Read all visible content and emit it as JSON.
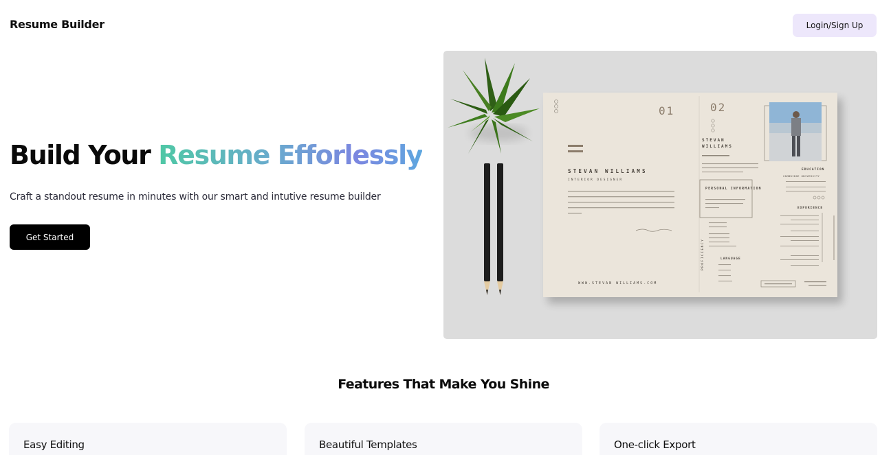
{
  "header": {
    "brand": "Resume Builder",
    "login_label": "Login/Sign Up"
  },
  "hero": {
    "title_plain": "Build Your ",
    "title_highlight": "Resume Efforlessly",
    "subtitle": "Craft a standout resume in minutes with our smart and intutive resume builder",
    "cta_label": "Get Started",
    "gradient_colors": [
      "#4fc8a5",
      "#6aa9cf",
      "#7b86e0",
      "#5ea7df"
    ]
  },
  "resume_mockup": {
    "page_one_number": "01",
    "page_two_number": "02",
    "name": "STEVAN WILLIAMS",
    "role": "INTERIOR DESIGNER",
    "name_first": "STEVAN",
    "name_last": "WILLIAMS",
    "personal_info_heading": "PERSONAL INFORMATION",
    "education_heading": "EDUCATION",
    "education_school": "CAMBRIDGE UNIVERSITY",
    "experience_heading": "EXPERIENCE",
    "language_heading": "LANGUAGE",
    "proficiency_label": "PROFICIENCY",
    "website": "WWW.STEVAN WILLIAMS.COM"
  },
  "features": {
    "heading": "Features That Make You Shine",
    "cards": [
      {
        "title": "Easy Editing"
      },
      {
        "title": "Beautiful Templates"
      },
      {
        "title": "One-click Export"
      }
    ]
  }
}
